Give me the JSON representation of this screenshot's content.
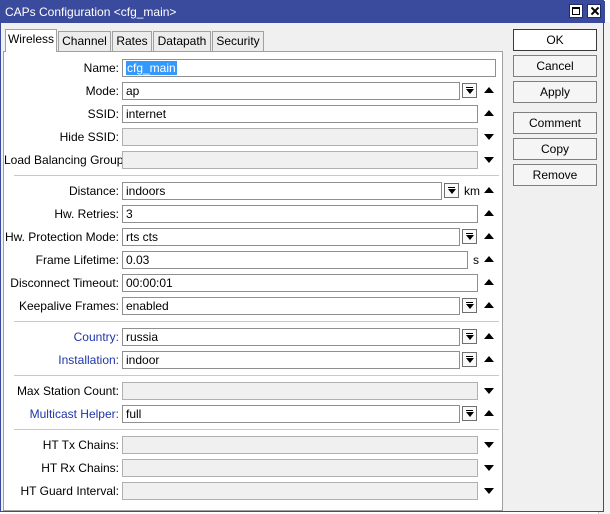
{
  "window": {
    "title": "CAPs Configuration <cfg_main>"
  },
  "tabs": [
    {
      "label": "Wireless",
      "active": true
    },
    {
      "label": "Channel"
    },
    {
      "label": "Rates"
    },
    {
      "label": "Datapath"
    },
    {
      "label": "Security"
    }
  ],
  "fields": {
    "name": {
      "label": "Name:",
      "value": "cfg_main"
    },
    "mode": {
      "label": "Mode:",
      "value": "ap"
    },
    "ssid": {
      "label": "SSID:",
      "value": "internet"
    },
    "hide_ssid": {
      "label": "Hide SSID:",
      "value": ""
    },
    "load_balancing_group": {
      "label": "Load Balancing Group:",
      "value": ""
    },
    "distance": {
      "label": "Distance:",
      "value": "indoors",
      "unit": "km"
    },
    "hw_retries": {
      "label": "Hw. Retries:",
      "value": "3"
    },
    "hw_protection_mode": {
      "label": "Hw. Protection Mode:",
      "value": "rts cts"
    },
    "frame_lifetime": {
      "label": "Frame Lifetime:",
      "value": "0.03",
      "unit": "s"
    },
    "disconnect_timeout": {
      "label": "Disconnect Timeout:",
      "value": "00:00:01"
    },
    "keepalive_frames": {
      "label": "Keepalive Frames:",
      "value": "enabled"
    },
    "country": {
      "label": "Country:",
      "value": "russia"
    },
    "installation": {
      "label": "Installation:",
      "value": "indoor"
    },
    "max_station_count": {
      "label": "Max Station Count:",
      "value": ""
    },
    "multicast_helper": {
      "label": "Multicast Helper:",
      "value": "full"
    },
    "ht_tx_chains": {
      "label": "HT Tx Chains:",
      "value": ""
    },
    "ht_rx_chains": {
      "label": "HT Rx Chains:",
      "value": ""
    },
    "ht_guard_interval": {
      "label": "HT Guard Interval:",
      "value": ""
    }
  },
  "buttons": {
    "ok": "OK",
    "cancel": "Cancel",
    "apply": "Apply",
    "comment": "Comment",
    "copy": "Copy",
    "remove": "Remove"
  },
  "colors": {
    "titlebar": "#3a4b9e",
    "link_label": "#1f36a8",
    "selection": "#3399ff"
  }
}
